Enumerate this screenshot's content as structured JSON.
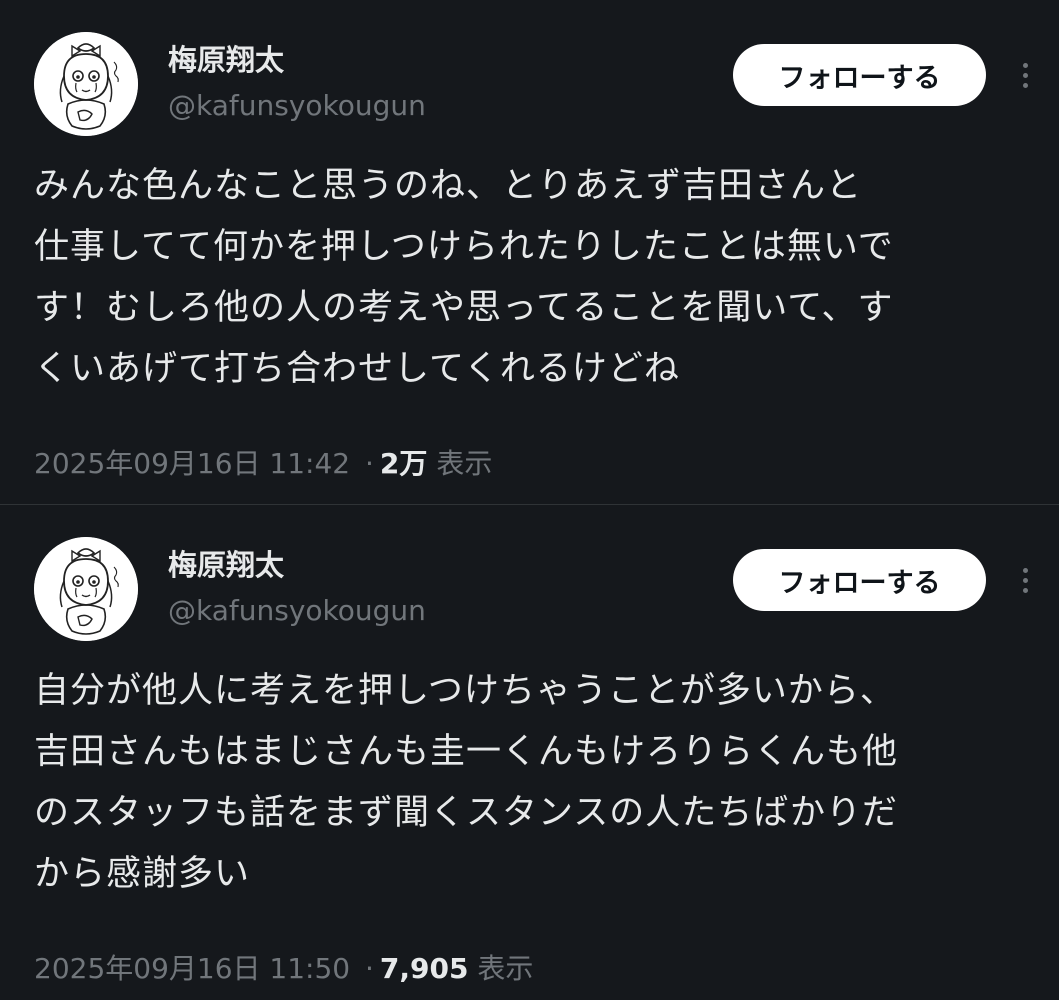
{
  "tweets": [
    {
      "author": {
        "display_name": "梅原翔太",
        "handle": "@kafunsyokougun",
        "avatar_icon": "avatar-drawing-icon"
      },
      "follow_label": "フォローする",
      "more_icon": "more-options-icon",
      "text_lines": [
        "みんな色んなこと思うのね、とりあえず吉田さんと",
        "仕事してて何かを押しつけられたりしたことは無いで",
        "す！むしろ他の人の考えや思ってることを聞いて、す",
        "くいあげて打ち合わせしてくれるけどね"
      ],
      "timestamp": "2025年09月16日 11:42",
      "separator": "·",
      "views_count": "2万",
      "views_label": "表示"
    },
    {
      "author": {
        "display_name": "梅原翔太",
        "handle": "@kafunsyokougun",
        "avatar_icon": "avatar-drawing-icon"
      },
      "follow_label": "フォローする",
      "more_icon": "more-options-icon",
      "text_lines": [
        "自分が他人に考えを押しつけちゃうことが多いから、",
        "吉田さんもはまじさんも圭一くんもけろりらくんも他",
        "のスタッフも話をまず聞くスタンスの人たちばかりだ",
        "から感謝多い"
      ],
      "timestamp": "2025年09月16日 11:50",
      "separator": "·",
      "views_count": "7,905",
      "views_label": "表示"
    }
  ],
  "colors": {
    "background": "#15181c",
    "text_primary": "#e7e9ea",
    "text_secondary": "#71767b",
    "divider": "#2f3336",
    "button_bg": "#ffffff",
    "button_text": "#0f1419"
  }
}
